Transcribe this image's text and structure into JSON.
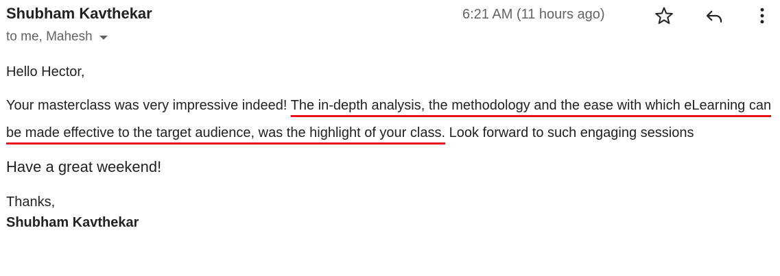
{
  "header": {
    "sender_name": "Shubham Kavthekar",
    "recipients": "to me, Mahesh",
    "timestamp": "6:21 AM (11 hours ago)",
    "icons": {
      "star": "star-icon",
      "reply": "reply-icon",
      "more": "more-vertical-icon",
      "caret": "chevron-down-icon"
    }
  },
  "message": {
    "greeting": "Hello Hector,",
    "paragraph_start": "Your masterclass was very impressive indeed! ",
    "paragraph_highlight": "The in-depth analysis, the methodology and the ease with which eLearning can be made effective to the target audience, was the highlight of your class.",
    "paragraph_end": " Look forward to such engaging sessions",
    "weekend_line": "Have a great weekend!",
    "closing": "Thanks,",
    "signature": "Shubham Kavthekar"
  },
  "colors": {
    "text": "#202124",
    "muted": "#5f6368",
    "underline": "#e8141c"
  }
}
